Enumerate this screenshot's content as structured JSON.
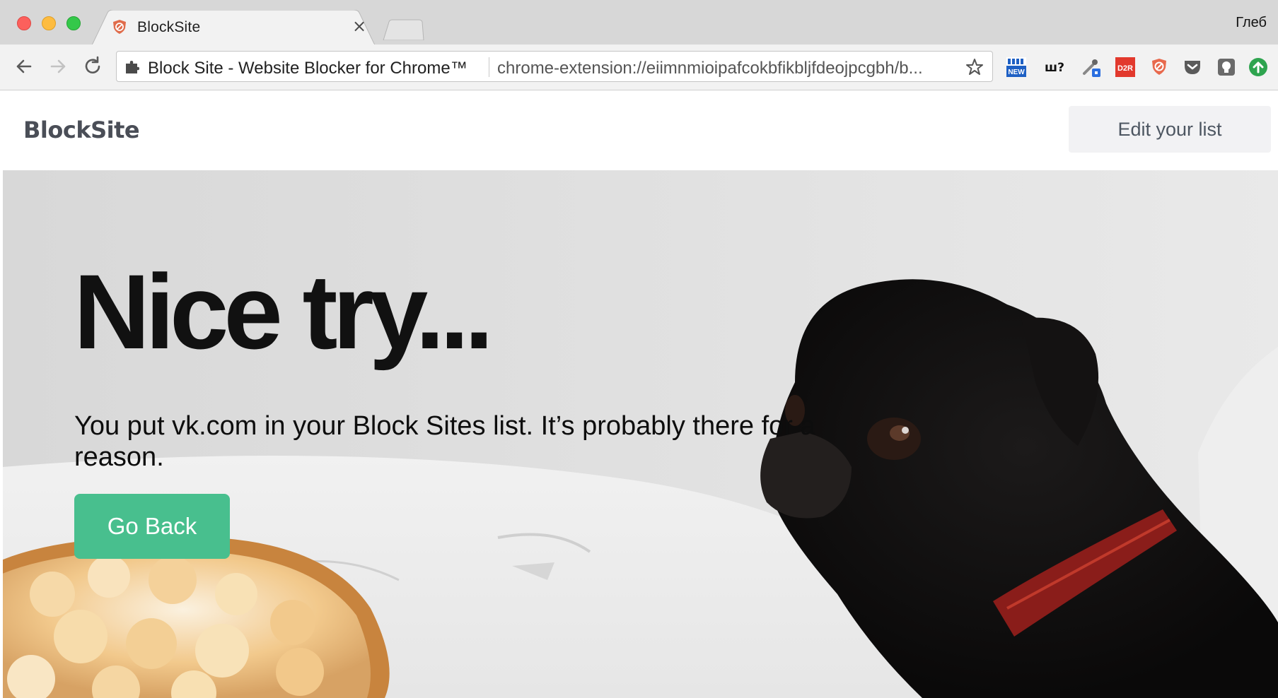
{
  "browser": {
    "tab": {
      "title": "BlockSite",
      "close_glyph": "×",
      "favicon": "blocksite-shield-icon"
    },
    "profile_name": "Глеб",
    "toolbar": {
      "back": "back-arrow-icon",
      "forward": "forward-arrow-icon",
      "reload": "reload-icon"
    },
    "omnibox": {
      "extension_name": "Block Site - Website Blocker for Chrome™",
      "url": "chrome-extension://eiimnmioipafcokbfikbljfdeojpcgbh/b...",
      "bookmark": "star-icon"
    },
    "extensions": [
      {
        "name": "new-extension-icon",
        "label": "NEW"
      },
      {
        "name": "shrift-extension-icon",
        "label": "ш?"
      },
      {
        "name": "eyedropper-extension-icon",
        "label": ""
      },
      {
        "name": "d2r-extension-icon",
        "label": "D2R"
      },
      {
        "name": "blocksite-extension-icon",
        "label": ""
      },
      {
        "name": "pocket-extension-icon",
        "label": ""
      },
      {
        "name": "lightbulb-extension-icon",
        "label": ""
      },
      {
        "name": "upload-extension-icon",
        "label": ""
      }
    ]
  },
  "page": {
    "logo": "BlockSite",
    "edit_button": "Edit your list",
    "headline": "Nice try...",
    "message": "You put vk.com in your Block Sites list. It’s probably there for a reason.",
    "go_back_button": "Go Back"
  },
  "colors": {
    "accent_green": "#48bf8e",
    "tabstrip": "#d7d7d7",
    "toolbar": "#f2f2f2",
    "edit_button_bg": "#f2f2f4"
  }
}
